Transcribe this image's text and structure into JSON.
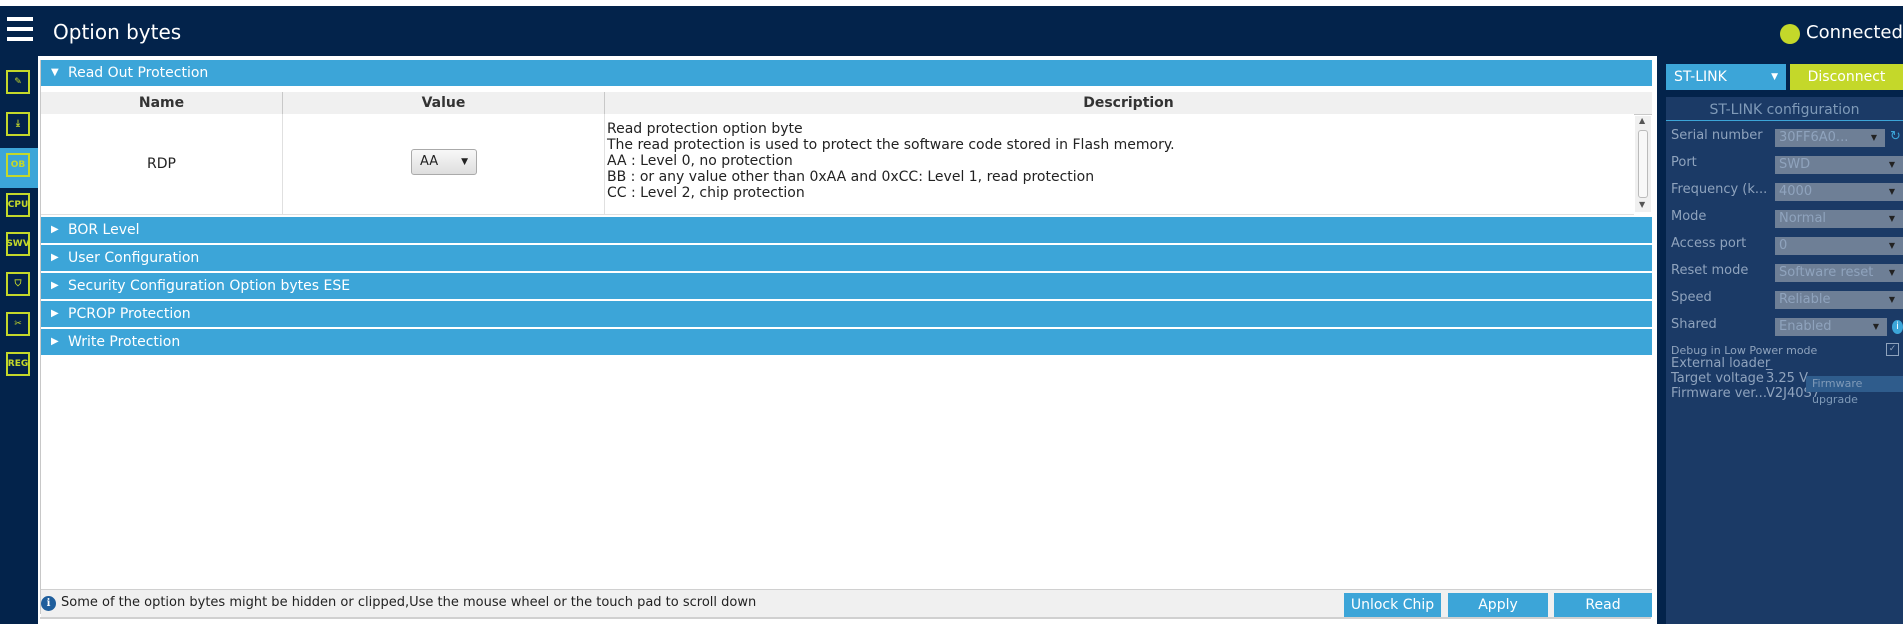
{
  "header": {
    "title": "Option bytes",
    "status": "Connected",
    "accent": "#c4d82a",
    "bar_color": "#03234b"
  },
  "sidebar": {
    "items": [
      {
        "icon": "pencil-edit-icon",
        "label": ""
      },
      {
        "icon": "download-icon",
        "label": ""
      },
      {
        "icon": "option-bytes-icon",
        "label": "OB"
      },
      {
        "icon": "cpu-icon",
        "label": "CPU"
      },
      {
        "icon": "swv-icon",
        "label": "SWV"
      },
      {
        "icon": "shield-icon",
        "label": ""
      },
      {
        "icon": "tools-icon",
        "label": ""
      },
      {
        "icon": "registers-icon",
        "label": "REG"
      }
    ]
  },
  "sections": {
    "read_out_protection": "Read Out Protection",
    "bor_level": "BOR Level",
    "user_configuration": "User Configuration",
    "security_configuration": "Security Configuration Option bytes ESE",
    "pcrop": "PCROP Protection",
    "write_protection": "Write Protection"
  },
  "table": {
    "columns": {
      "name": "Name",
      "value": "Value",
      "description": "Description"
    },
    "rows": [
      {
        "name": "RDP",
        "value": "AA",
        "description": [
          "Read protection option byte",
          "The read protection is used to protect the software code stored in Flash memory.",
          "AA : Level 0, no protection",
          "BB : or any value other than 0xAA and 0xCC: Level 1, read protection",
          "CC : Level 2, chip protection"
        ]
      }
    ]
  },
  "footer": {
    "info": "Some of the option bytes might be hidden or clipped,Use the mouse wheel or the touch pad to scroll down",
    "buttons": {
      "unlock": "Unlock Chip",
      "apply": "Apply",
      "read": "Read"
    }
  },
  "right_panel": {
    "probe_select": "ST-LINK",
    "disconnect": "Disconnect",
    "config_title": "ST-LINK configuration",
    "fields": {
      "serial_number": {
        "label": "Serial number",
        "value": "30FF6A0..."
      },
      "port": {
        "label": "Port",
        "value": "SWD"
      },
      "frequency": {
        "label": "Frequency (k...",
        "value": "4000"
      },
      "mode": {
        "label": "Mode",
        "value": "Normal"
      },
      "access_port": {
        "label": "Access port",
        "value": "0"
      },
      "reset_mode": {
        "label": "Reset mode",
        "value": "Software reset"
      },
      "speed": {
        "label": "Speed",
        "value": "Reliable"
      },
      "shared": {
        "label": "Shared",
        "value": "Enabled"
      }
    },
    "debug_low_power": "Debug in Low Power mode",
    "external_loader": {
      "label": "External loader",
      "value": "_"
    },
    "target_voltage": {
      "label": "Target voltage",
      "value": "3.25 V"
    },
    "firmware_version": {
      "label": "Firmware ver...",
      "value": "V2J40S7"
    },
    "firmware_upgrade": "Firmware upgrade"
  }
}
